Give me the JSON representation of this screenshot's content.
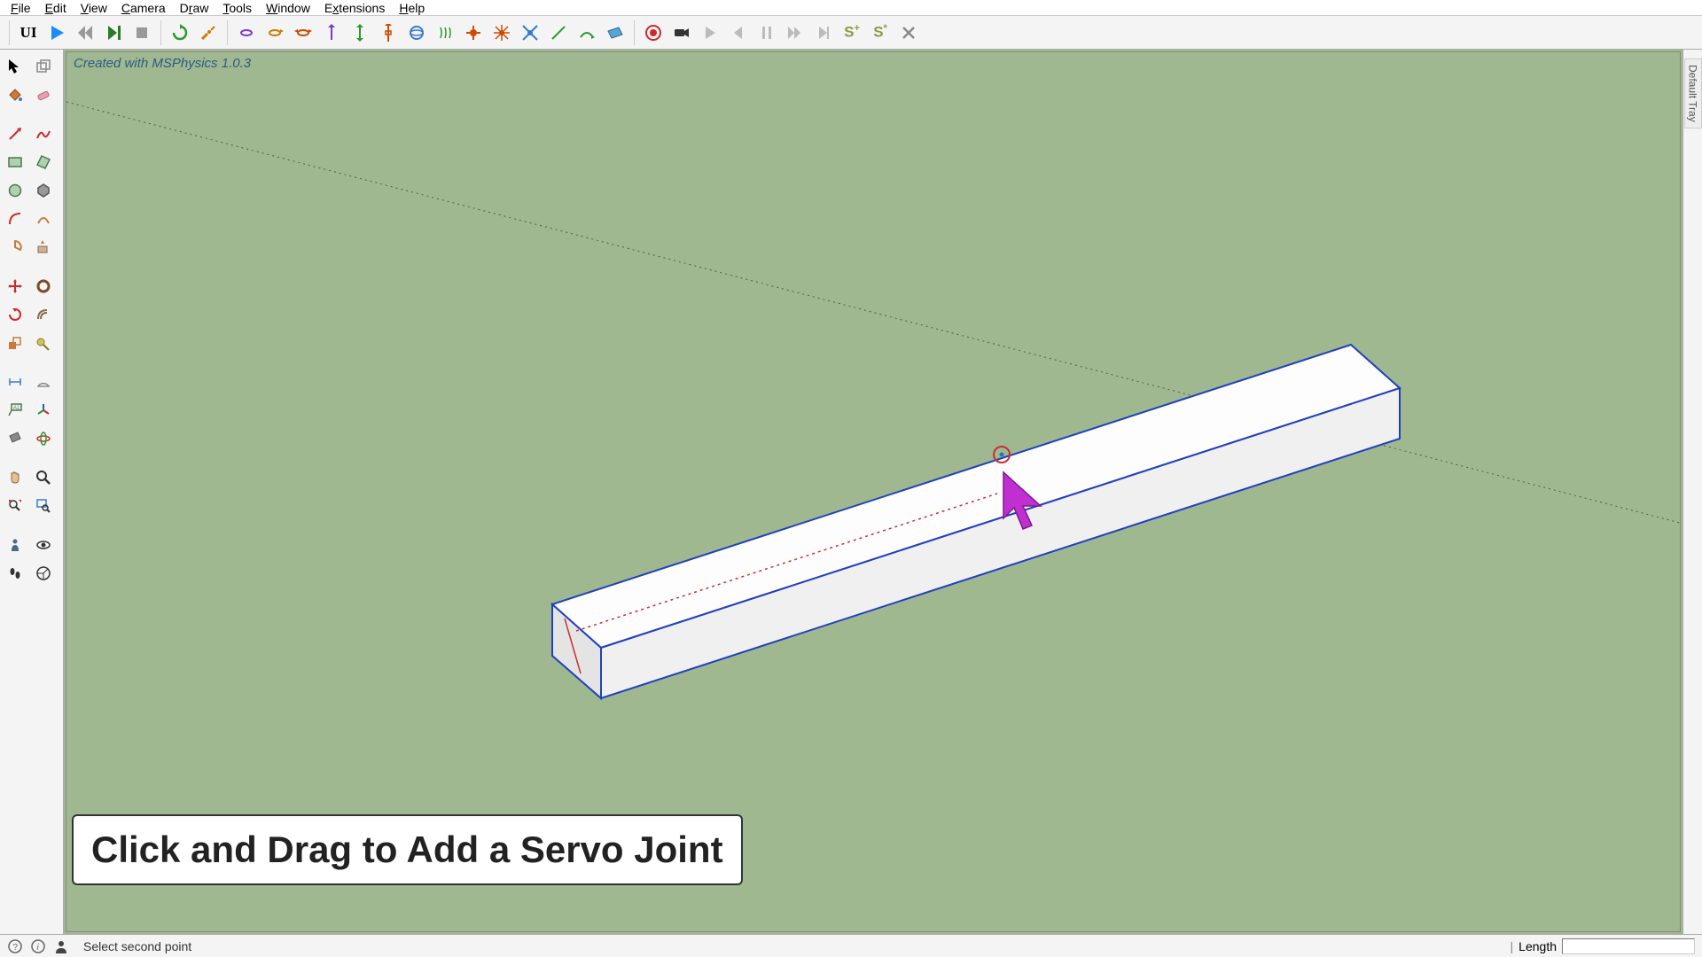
{
  "menu": {
    "file": "File",
    "edit": "Edit",
    "view": "View",
    "camera": "Camera",
    "draw": "Draw",
    "tools": "Tools",
    "window": "Window",
    "extensions": "Extensions",
    "help": "Help"
  },
  "watermark": "Created with MSPhysics 1.0.3",
  "instruction": "Click and Drag to Add a Servo Joint",
  "status": {
    "message": "Select second point",
    "measurement_label": "Length",
    "measurement_value": ""
  },
  "right_tab": "Default Tray",
  "toolbar": {
    "ui": "UI",
    "play": "play",
    "rewind": "rewind",
    "stepfwd": "step-forward",
    "stop": "stop",
    "loop": "loop",
    "joint_tool": "joint-tool",
    "hinge": "hinge",
    "motor": "motor",
    "servo": "servo",
    "slider": "slider",
    "piston": "piston",
    "spring": "spring",
    "up_vector": "up-vector",
    "gyro": "gyro",
    "fixed": "fixed",
    "ball": "ball",
    "universal": "universal",
    "corkscrew": "corkscrew",
    "curvy_slider": "curvy-slider",
    "curvy_piston": "curvy-piston",
    "plane": "plane",
    "record": "record",
    "camera": "camera",
    "playrec": "play-rec",
    "prev": "prev",
    "pause": "pause",
    "ffwd": "fast-fwd",
    "next": "next",
    "s_plus": "S+",
    "s_star": "S*",
    "close": "close"
  },
  "left_tools": {
    "select": "select",
    "component": "make-component",
    "paint": "paint-bucket",
    "eraser": "eraser",
    "line": "line",
    "freehand": "freehand",
    "rectangle": "rectangle",
    "rotated_rect": "rotated-rectangle",
    "circle": "circle",
    "polygon": "polygon",
    "arc": "arc",
    "twopoint_arc": "2-point-arc",
    "pie": "pie",
    "push_pull": "push-pull",
    "move": "move",
    "follow_me": "follow-me",
    "rotate": "rotate",
    "offset": "offset",
    "scale": "scale",
    "tape": "tape-measure",
    "dim": "dimension",
    "protractor": "protractor",
    "text": "text",
    "axes": "axes",
    "section": "section-plane",
    "orbit": "orbit",
    "pan": "pan",
    "zoom": "zoom",
    "zoom_ext": "zoom-extents",
    "zoom_win": "zoom-window",
    "position_camera": "position-camera",
    "walk": "walk",
    "look": "look-around",
    "prev_view": "previous-view"
  },
  "chart_data": {}
}
